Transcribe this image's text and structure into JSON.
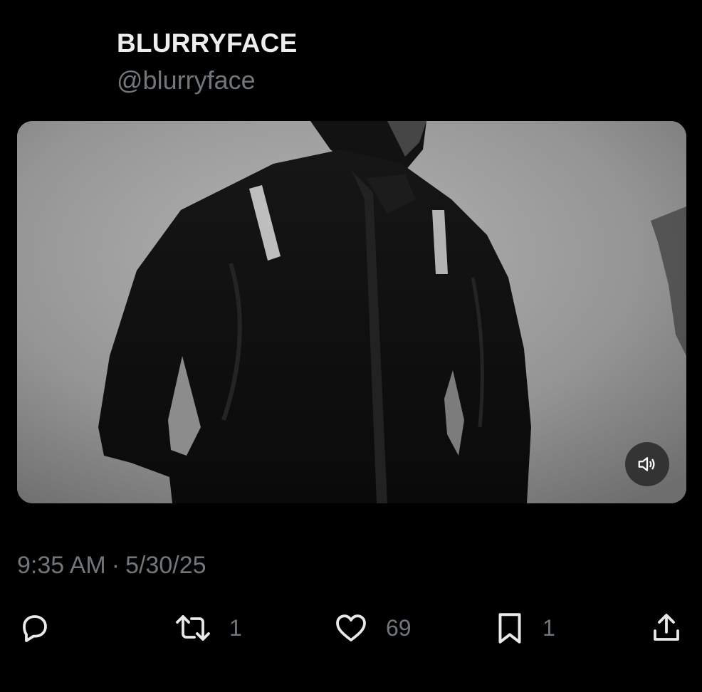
{
  "tweet": {
    "display_name": "BLURRYFACE",
    "handle": "@blurryface",
    "time": "9:35 AM",
    "separator": "·",
    "date": "5/30/25"
  },
  "media": {
    "type": "video",
    "description_icon": "speaker-icon",
    "mute_button_icon": "speaker-icon"
  },
  "actions": {
    "reply": {
      "icon": "reply-icon",
      "count": ""
    },
    "retweet": {
      "icon": "retweet-icon",
      "count": "1"
    },
    "like": {
      "icon": "heart-icon",
      "count": "69"
    },
    "bookmark": {
      "icon": "bookmark-icon",
      "count": "1"
    },
    "share": {
      "icon": "share-icon",
      "count": ""
    }
  },
  "colors": {
    "background": "#000000",
    "primary_text": "#ededed",
    "secondary_text": "#71767b"
  }
}
